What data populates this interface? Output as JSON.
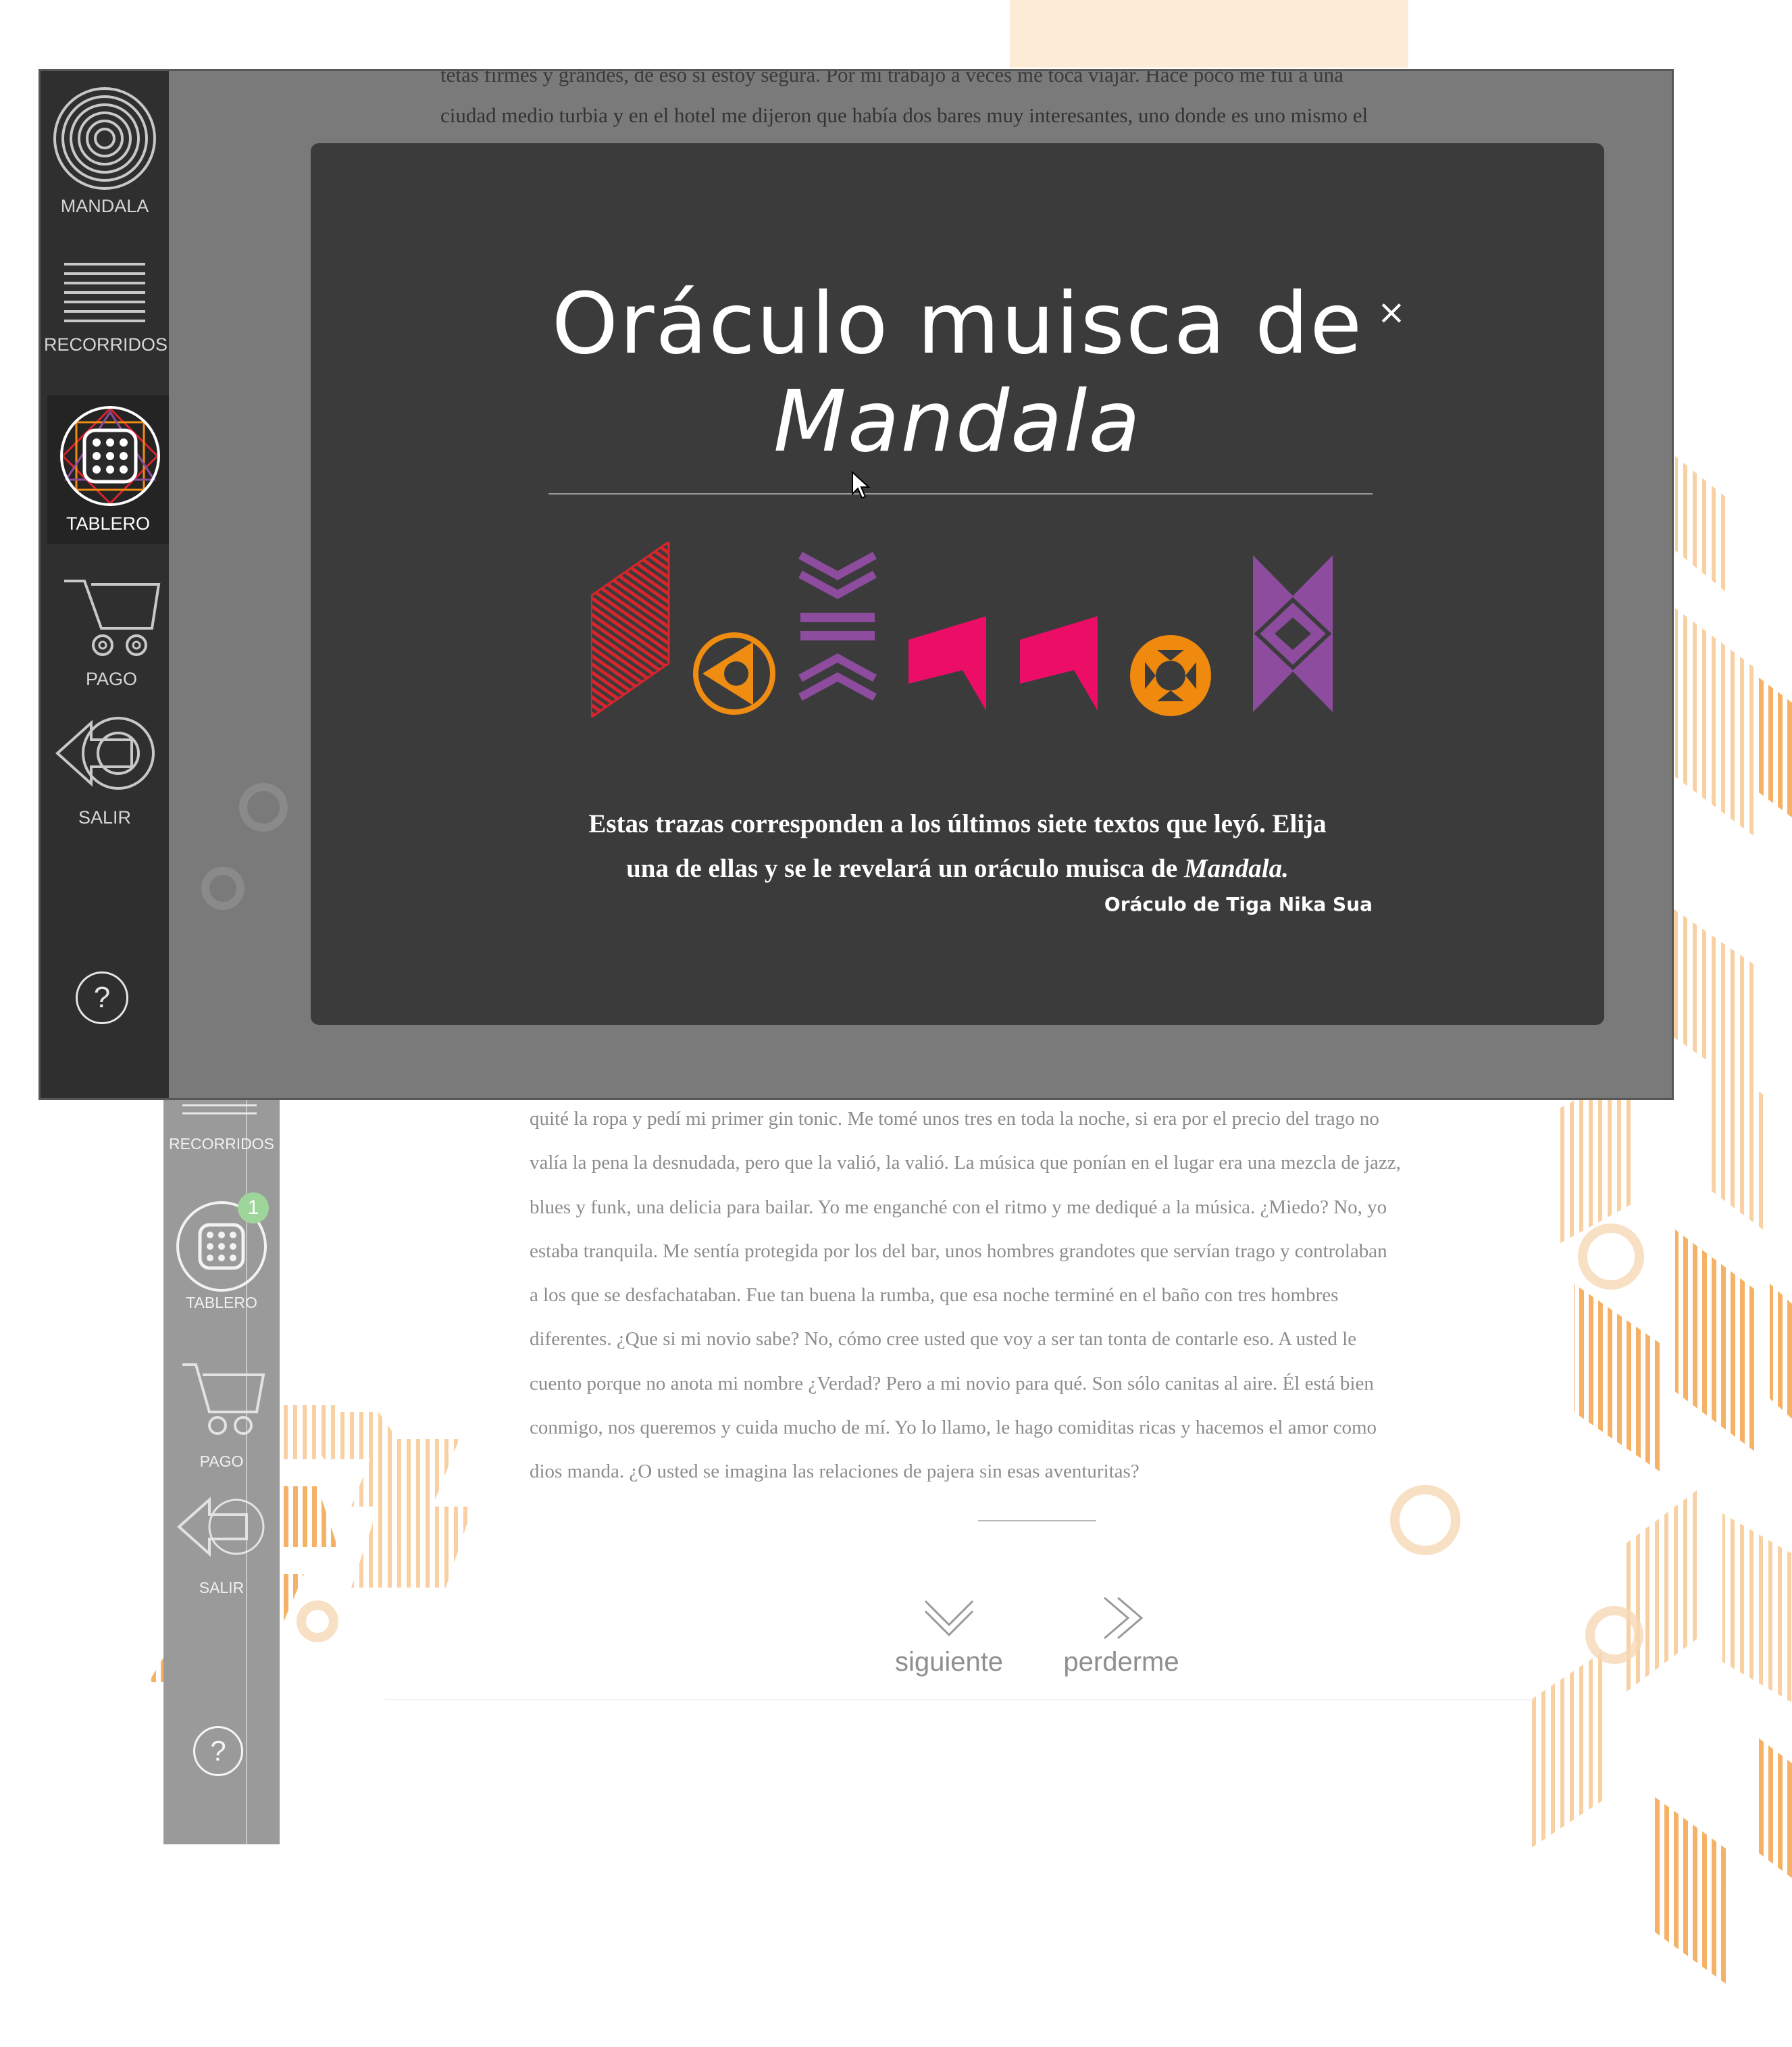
{
  "sidebar": {
    "items": [
      {
        "label": "MANDALA"
      },
      {
        "label": "RECORRIDOS"
      },
      {
        "label": "TABLERO"
      },
      {
        "label": "PAGO"
      },
      {
        "label": "SALIR"
      }
    ],
    "help": "?",
    "tablero_badge": "1"
  },
  "article": {
    "top_lines": [
      "tetas firmes y grandes, de eso sí estoy segura. Por mi trabajo a veces me toca viajar. Hace poco me fui a una",
      "ciudad medio turbia y en el hotel me dijeron que había dos bares muy interesantes, uno donde es uno mismo el"
    ],
    "lines": [
      "quité la ropa y pedí mi primer gin tonic. Me tomé unos tres en toda la noche, si era por el precio del trago no",
      "valía la pena la desnudada, pero que la valió, la valió. La música que ponían en el lugar era una mezcla de jazz,",
      "blues y funk, una delicia para bailar. Yo me enganché con el ritmo y me dediqué a la música. ¿Miedo? No, yo",
      "estaba tranquila. Me sentía protegida por los del bar, unos hombres grandotes que servían trago y controlaban",
      "a los que se desfachataban. Fue tan buena la rumba, que esa noche terminé en el baño con tres hombres",
      "diferentes. ¿Que si mi novio sabe? No, cómo cree usted que voy a ser tan tonta de contarle eso. A usted le",
      "cuento porque no anota mi nombre ¿Verdad? Pero a mi novio para qué. Son sólo canitas al aire. Él está bien",
      "conmigo, nos queremos y cuida mucho de mí. Yo lo llamo, le hago comiditas ricas y hacemos el amor como",
      "dios manda. ¿O usted se imagina las relaciones de pajera sin esas aventuritas?"
    ],
    "nav": {
      "next": "siguiente",
      "lose": "perderme"
    }
  },
  "modal": {
    "title_line1": "Oráculo muisca de",
    "title_line2": "Mandala",
    "close": "×",
    "description_line1": "Estas trazas corresponden a los últimos siete textos que leyó. Elija",
    "description_line2_prefix": "una de ellas y se le revelará un oráculo muisca de ",
    "description_line2_em": "Mandala.",
    "credit": "Oráculo de Tiga Nika Sua",
    "traces": [
      {
        "name": "red-parallelogram",
        "color": "#d9242c"
      },
      {
        "name": "orange-circle-triangle",
        "color": "#ef8c12"
      },
      {
        "name": "purple-chevrons",
        "color": "#8e4c9f"
      },
      {
        "name": "pink-bowtie-left",
        "color": "#ec0d67"
      },
      {
        "name": "pink-bowtie-right",
        "color": "#ec0d67"
      },
      {
        "name": "orange-disc",
        "color": "#f08a0f"
      },
      {
        "name": "purple-diamond-panel",
        "color": "#8e4c9f"
      }
    ]
  },
  "colors": {
    "accent_orange": "#f3a24a",
    "peach": "#fdebd6",
    "modal_bg": "#3b3b3c",
    "badge_green": "#9ed59a"
  }
}
